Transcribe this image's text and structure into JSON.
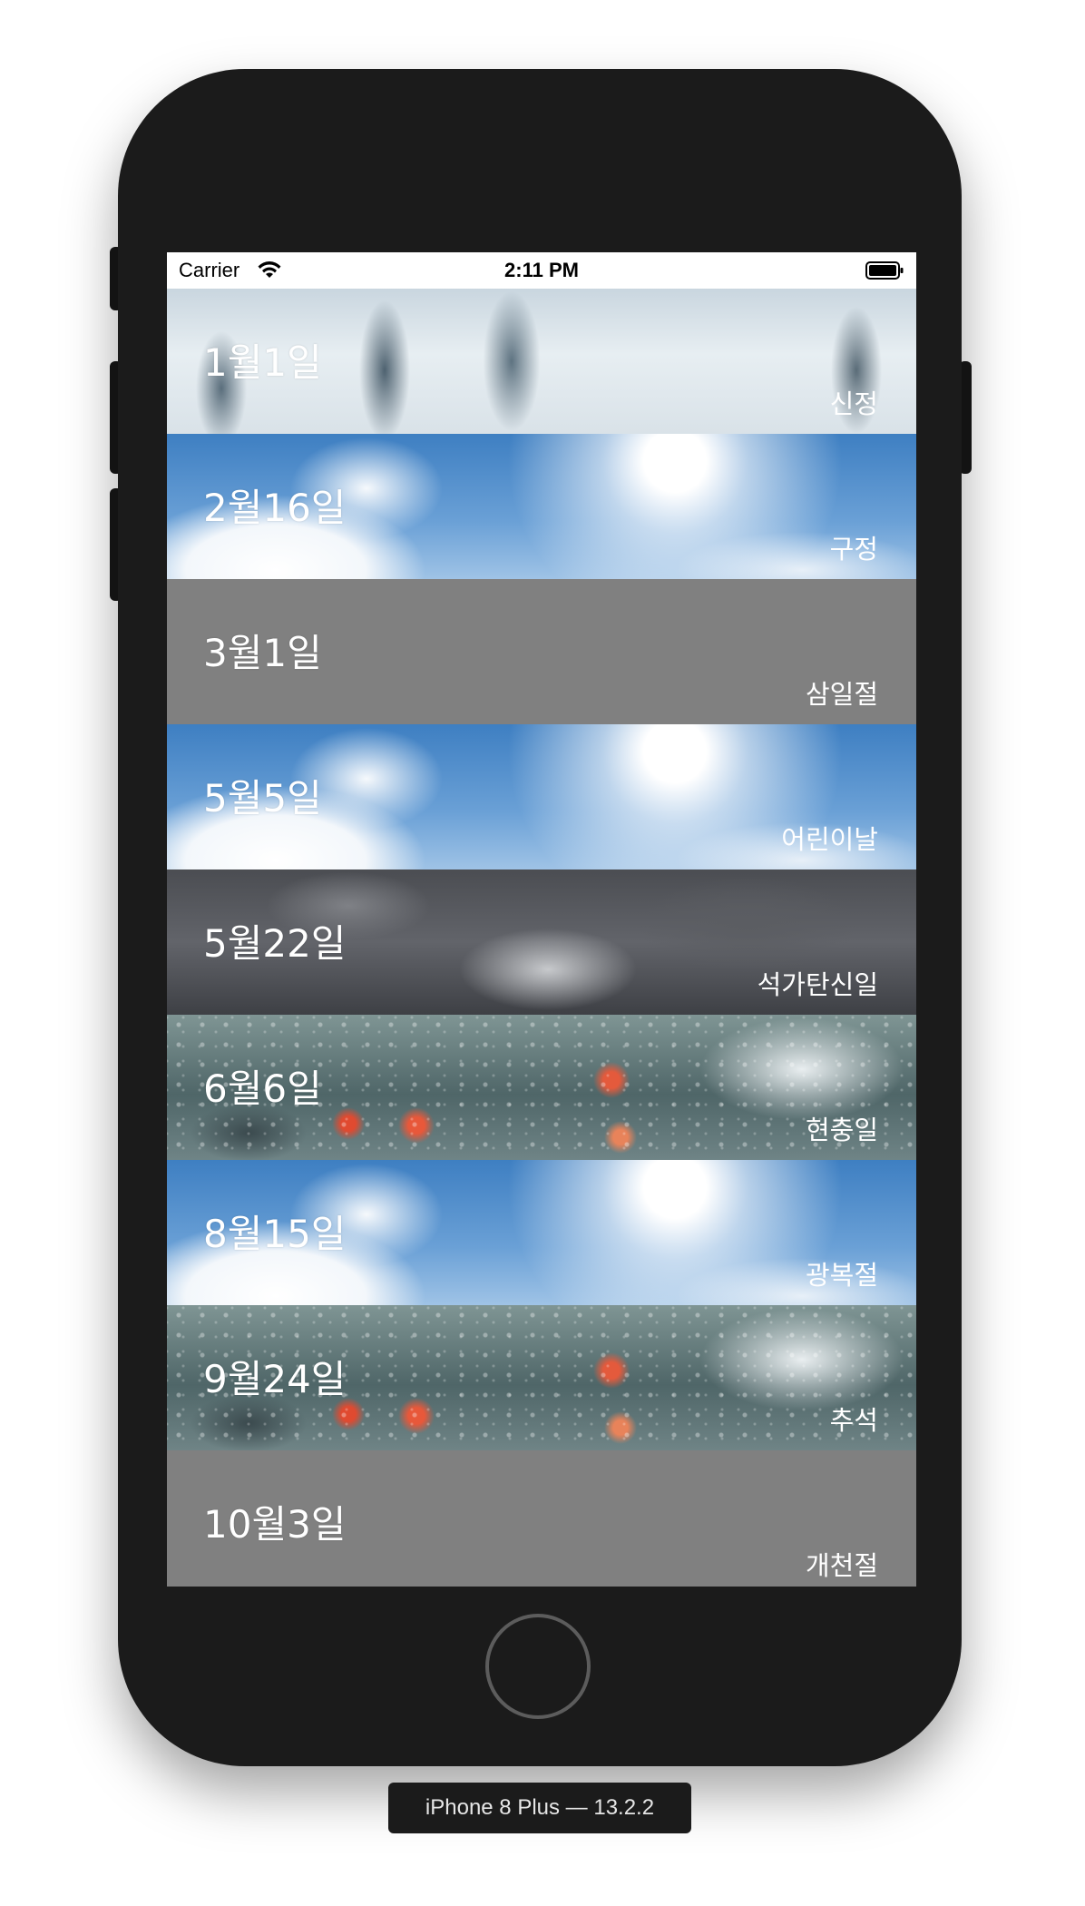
{
  "status_bar": {
    "carrier": "Carrier",
    "time": "2:11 PM",
    "wifi_icon": "wifi-icon",
    "battery_icon": "battery-icon"
  },
  "holidays": [
    {
      "date": "1월1일",
      "name": "신정",
      "background": "snow"
    },
    {
      "date": "2월16일",
      "name": "구정",
      "background": "sunny"
    },
    {
      "date": "3월1일",
      "name": "삼일절",
      "background": "gray"
    },
    {
      "date": "5월5일",
      "name": "어린이날",
      "background": "sunny"
    },
    {
      "date": "5월22일",
      "name": "석가탄신일",
      "background": "cloudy"
    },
    {
      "date": "6월6일",
      "name": "현충일",
      "background": "rain"
    },
    {
      "date": "8월15일",
      "name": "광복절",
      "background": "sunny"
    },
    {
      "date": "9월24일",
      "name": "추석",
      "background": "rain"
    },
    {
      "date": "10월3일",
      "name": "개천절",
      "background": "gray"
    }
  ],
  "device": {
    "label": "iPhone 8 Plus — 13.2.2"
  },
  "colors": {
    "device_body": "#1b1b1b",
    "cell_gray": "#808080",
    "text": "#ffffff"
  }
}
